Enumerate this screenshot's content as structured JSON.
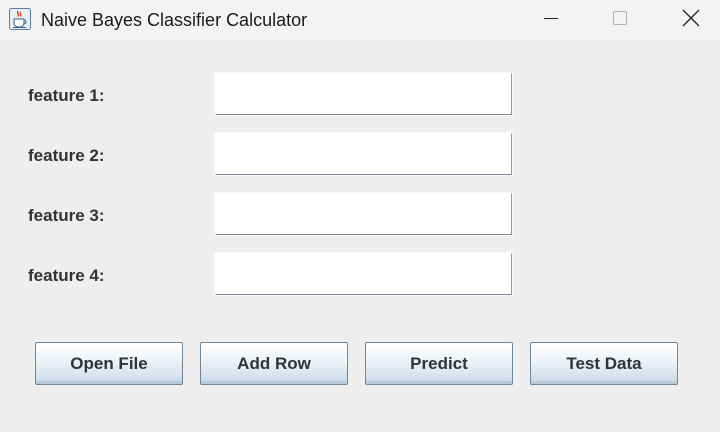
{
  "window": {
    "title": "Naive Bayes Classifier Calculator",
    "icon": "java-cup-icon"
  },
  "titlebar_controls": {
    "minimize_icon": "minimize-icon",
    "maximize_icon": "maximize-icon",
    "close_icon": "close-icon"
  },
  "form": {
    "features": [
      {
        "label": "feature 1:",
        "value": ""
      },
      {
        "label": "feature 2:",
        "value": ""
      },
      {
        "label": "feature 3:",
        "value": ""
      },
      {
        "label": "feature 4:",
        "value": ""
      }
    ]
  },
  "buttons": {
    "open_file": "Open File",
    "add_row": "Add Row",
    "predict": "Predict",
    "test_data": "Test Data"
  }
}
